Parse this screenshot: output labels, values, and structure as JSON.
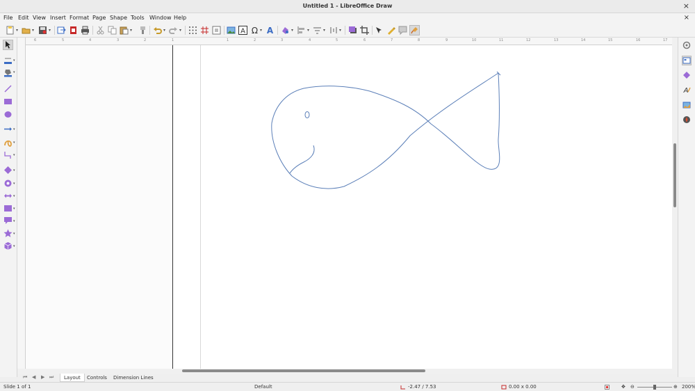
{
  "window": {
    "title": "Untitled 1 - LibreOffice Draw"
  },
  "menubar": {
    "items": [
      "File",
      "Edit",
      "View",
      "Insert",
      "Format",
      "Page",
      "Shape",
      "Tools",
      "Window",
      "Help"
    ]
  },
  "ruler": {
    "h_labels": [
      "6",
      "5",
      "4",
      "3",
      "2",
      "1",
      "1",
      "2",
      "3",
      "4",
      "5",
      "6",
      "7",
      "8",
      "9",
      "10",
      "11",
      "12",
      "13",
      "14",
      "15",
      "16",
      "17"
    ]
  },
  "tabs": [
    "Layout",
    "Controls",
    "Dimension Lines"
  ],
  "status": {
    "slide": "Slide 1 of 1",
    "layout": "Default",
    "position": "-2.47 / 7.53",
    "size": "0.00 x 0.00",
    "zoom": "200%"
  },
  "colors": {
    "stroke": "#5b7fb8",
    "accent_purple": "#9b6bd6",
    "accent_blue": "#3b6cc4"
  }
}
